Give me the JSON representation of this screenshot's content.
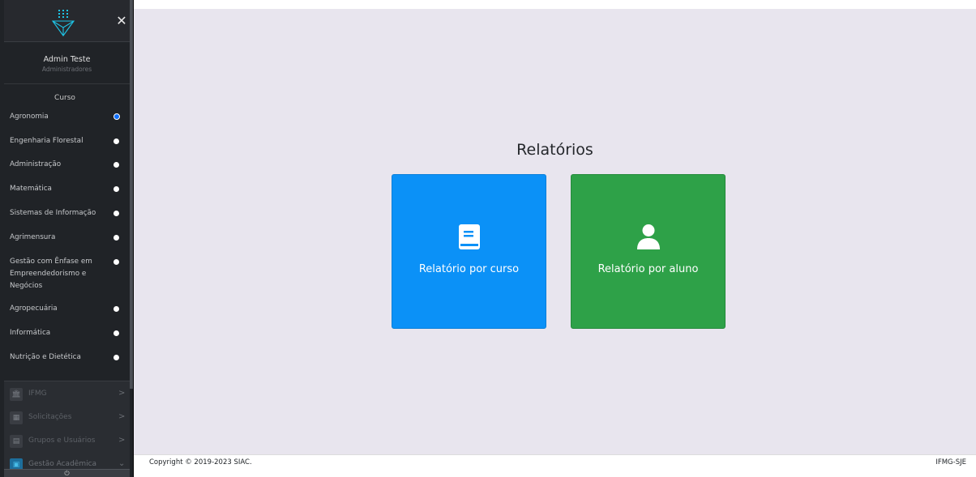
{
  "user": {
    "name": "Admin Teste",
    "role": "Administradores"
  },
  "sidebar": {
    "close_icon": "close-icon",
    "section_title": "Curso",
    "courses": [
      {
        "label": "Agronomia",
        "selected": true
      },
      {
        "label": "Engenharia Florestal",
        "selected": false
      },
      {
        "label": "Administração",
        "selected": false
      },
      {
        "label": "Matemática",
        "selected": false
      },
      {
        "label": "Sistemas de Informação",
        "selected": false
      },
      {
        "label": "Agrimensura",
        "selected": false
      },
      {
        "label": "Gestão com Ênfase em Empreendedorismo e Negócios",
        "selected": false
      },
      {
        "label": "Agropecuária",
        "selected": false
      },
      {
        "label": "Informática",
        "selected": false
      },
      {
        "label": "Nutrição e Dietética",
        "selected": false
      }
    ],
    "menu": [
      {
        "label": "IFMG",
        "icon": "institution-icon",
        "chevron": ">"
      },
      {
        "label": "Solicitações",
        "icon": "calendar-icon",
        "chevron": ">"
      },
      {
        "label": "Grupos e Usuários",
        "icon": "id-card-icon",
        "chevron": ">"
      },
      {
        "label": "Gestão Acadêmica",
        "icon": "chalkboard-icon",
        "chevron": "⌄"
      }
    ],
    "logout_icon": "power-icon"
  },
  "main": {
    "title": "Relatórios",
    "cards": [
      {
        "label": "Relatório por curso",
        "icon": "book-icon",
        "color": "#0b91f7"
      },
      {
        "label": "Relatório por aluno",
        "icon": "user-icon",
        "color": "#2ea148"
      }
    ]
  },
  "footer": {
    "copyright": "Copyright © 2019-2023 SIAC.",
    "right_text": "IFMG-SJE"
  }
}
